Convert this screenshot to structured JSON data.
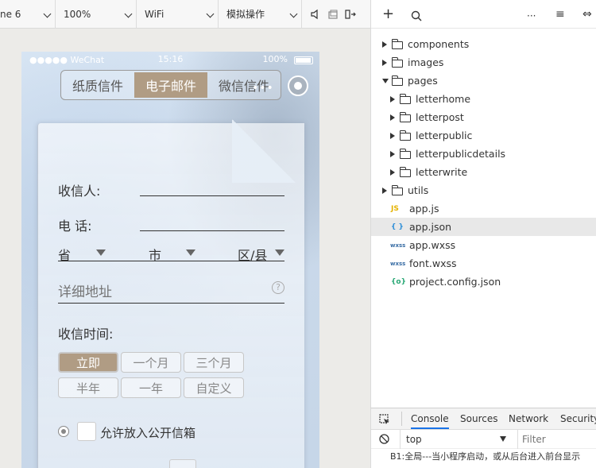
{
  "toolbar": {
    "device": "ne 6",
    "zoom": "100%",
    "network": "WiFi",
    "mode": "模拟操作"
  },
  "phone": {
    "status": {
      "signal": "●●●●● WeChat",
      "time": "15:16",
      "battery": "100%"
    },
    "tabs": [
      "纸质信件",
      "电子邮件",
      "微信信件"
    ],
    "active_tab": "电子邮件",
    "capsule_dots": "•••",
    "form": {
      "recipient_label": "收信人:",
      "phone_label": "电 话:",
      "province": "省",
      "city": "市",
      "district": "区/县",
      "detail_placeholder": "详细地址",
      "help_glyph": "?",
      "time_label": "收信时间:",
      "time_options_row1": [
        "立即",
        "一个月",
        "三个月"
      ],
      "time_options_row2": [
        "半年",
        "一年",
        "自定义"
      ],
      "selected_option": "立即",
      "public_label": "允许放入公开信箱"
    }
  },
  "explorer": {
    "tree": [
      {
        "label": "components",
        "type": "folder",
        "depth": 0,
        "expanded": false
      },
      {
        "label": "images",
        "type": "folder",
        "depth": 0,
        "expanded": false
      },
      {
        "label": "pages",
        "type": "folder",
        "depth": 0,
        "expanded": true
      },
      {
        "label": "letterhome",
        "type": "folder",
        "depth": 1,
        "expanded": false
      },
      {
        "label": "letterpost",
        "type": "folder",
        "depth": 1,
        "expanded": false
      },
      {
        "label": "letterpublic",
        "type": "folder",
        "depth": 1,
        "expanded": false
      },
      {
        "label": "letterpublicdetails",
        "type": "folder",
        "depth": 1,
        "expanded": false
      },
      {
        "label": "letterwrite",
        "type": "folder",
        "depth": 1,
        "expanded": false
      },
      {
        "label": "utils",
        "type": "folder",
        "depth": 0,
        "expanded": false
      },
      {
        "label": "app.js",
        "type": "js",
        "depth": 0
      },
      {
        "label": "app.json",
        "type": "json",
        "depth": 0,
        "selected": true
      },
      {
        "label": "app.wxss",
        "type": "wxss",
        "depth": 0
      },
      {
        "label": "font.wxss",
        "type": "wxss",
        "depth": 0
      },
      {
        "label": "project.config.json",
        "type": "config",
        "depth": 0
      }
    ],
    "badges": {
      "js": "JS",
      "json": "{ }",
      "wxss": "wxss",
      "config": "{o}"
    },
    "badge_colors": {
      "js": "#e5b300",
      "json": "#2f8fd8",
      "wxss": "#3a6ea5",
      "config": "#2aa876"
    },
    "actions": {
      "add": "+",
      "search": "⌕",
      "more": "···",
      "sort": "≡",
      "collapse": "⇔"
    }
  },
  "console": {
    "tabs": [
      "Console",
      "Sources",
      "Network",
      "Security"
    ],
    "active_tab": "Console",
    "context": "top",
    "filter_placeholder": "Filter",
    "log_line": "B1:全局---当小程序启动，或从后台进入前台显示"
  },
  "colors": {
    "accent_tab": "#b09c84",
    "console_active": "#1a73e8"
  }
}
